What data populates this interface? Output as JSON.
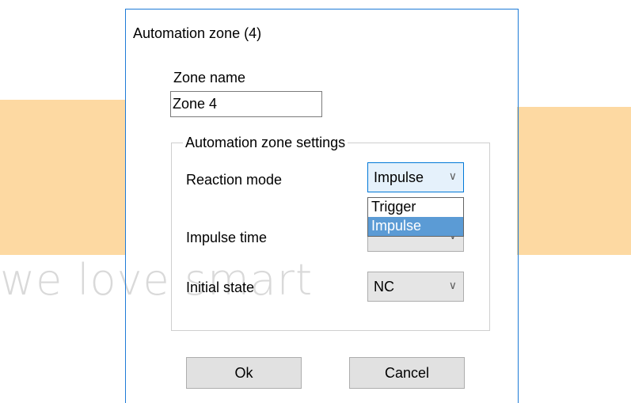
{
  "watermark": {
    "tagline": "we love smart"
  },
  "dialog": {
    "title": "Automation zone (4)",
    "zone_name_label": "Zone name",
    "zone_name_value": "Zone 4",
    "group_title": "Automation zone settings",
    "reaction_mode": {
      "label": "Reaction mode",
      "selected": "Impulse",
      "options": [
        "Trigger",
        "Impulse"
      ],
      "highlighted": "Impulse"
    },
    "impulse_time": {
      "label": "Impulse time"
    },
    "initial_state": {
      "label": "Initial state",
      "selected": "NC"
    },
    "ok_label": "Ok",
    "cancel_label": "Cancel"
  },
  "colors": {
    "accent": "#0078d7",
    "selection": "#5b9bd5",
    "watermark_orange": "#fdd9a2"
  },
  "icons": {
    "combo_arrow": "chevron-down-icon"
  }
}
